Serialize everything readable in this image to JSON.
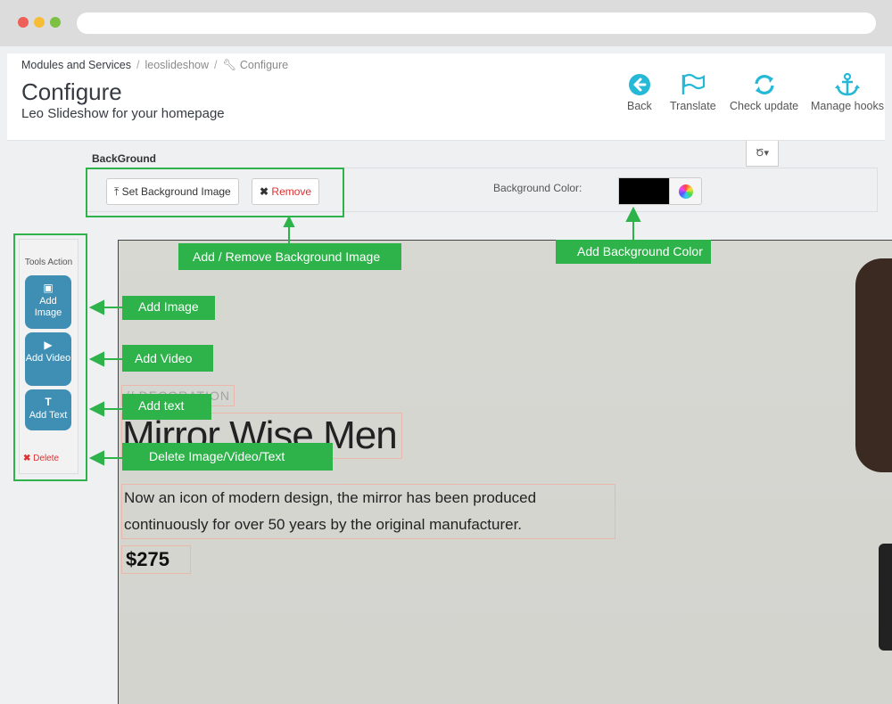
{
  "breadcrumb": {
    "item1": "Modules and Services",
    "sep": "/",
    "item2": "leoslideshow",
    "item3": "Configure"
  },
  "page": {
    "title": "Configure",
    "subtitle": "Leo Slideshow for your homepage"
  },
  "toolbar": {
    "back": "Back",
    "translate": "Translate",
    "check_update": "Check update",
    "manage_hooks": "Manage hooks"
  },
  "background": {
    "label": "BackGround",
    "set_image": "Set Background Image",
    "remove": "Remove",
    "color_label": "Background Color:",
    "color_value": "#000000",
    "dropdown": "Ծ▾"
  },
  "tools": {
    "title": "Tools Action",
    "add_image": "Add Image",
    "add_video": "Add Video",
    "add_text": "Add Text",
    "delete": "Delete"
  },
  "slide": {
    "decoration": "// DECORATION",
    "headline": "Mirror Wise Men",
    "body": "Now an icon of modern design, the mirror has been produced continuously for over 50 years by the original manufacturer.",
    "price": "$275"
  },
  "annotations": {
    "bg_image": "Add / Remove Background Image",
    "bg_color": "Add Background Color",
    "add_image": "Add Image",
    "add_video": "Add Video",
    "add_text": "Add text",
    "delete": "Delete Image/Video/Text"
  },
  "colors": {
    "accent": "#25b9d7",
    "annotation": "#2db34a",
    "tool_button": "#3f8fb4",
    "danger": "#e03030"
  }
}
